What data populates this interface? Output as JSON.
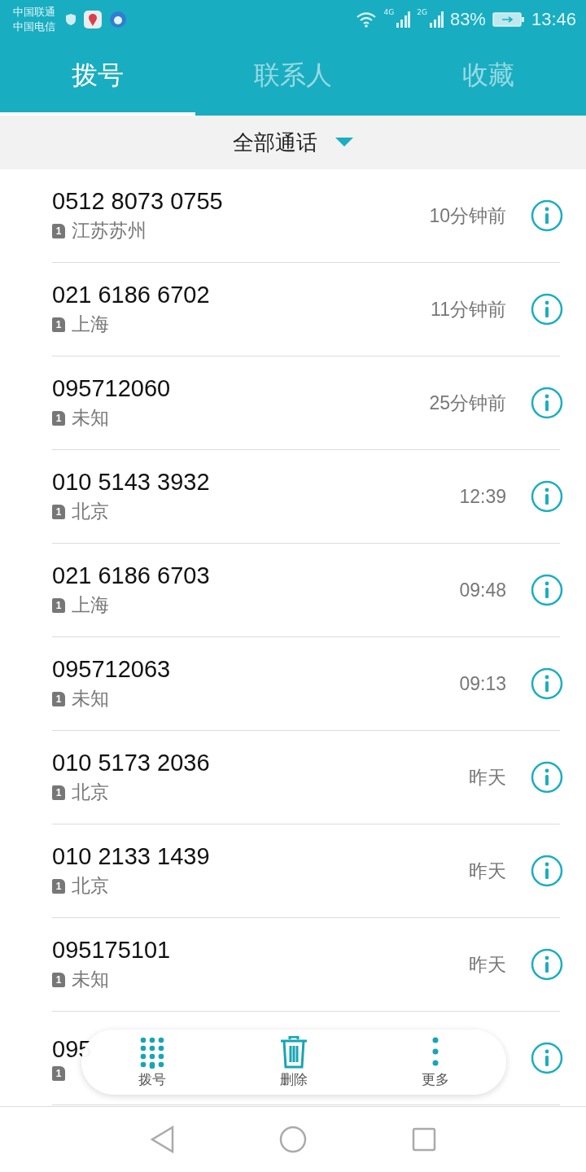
{
  "status_bar": {
    "carriers": [
      "中国联通",
      "中国电信"
    ],
    "battery_percent": "83%",
    "time": "13:46",
    "network_1": "4G",
    "network_2": "2G"
  },
  "tabs": [
    {
      "label": "拨号",
      "selected": true
    },
    {
      "label": "联系人",
      "selected": false
    },
    {
      "label": "收藏",
      "selected": false
    }
  ],
  "filter": {
    "label": "全部通话"
  },
  "calls": [
    {
      "number": "0512 8073 0755",
      "sim": "1",
      "location": "江苏苏州",
      "time": "10分钟前"
    },
    {
      "number": "021 6186 6702",
      "sim": "1",
      "location": "上海",
      "time": "11分钟前"
    },
    {
      "number": "095712060",
      "sim": "1",
      "location": "未知",
      "time": "25分钟前"
    },
    {
      "number": "010 5143 3932",
      "sim": "1",
      "location": "北京",
      "time": "12:39"
    },
    {
      "number": "021 6186 6703",
      "sim": "1",
      "location": "上海",
      "time": "09:48"
    },
    {
      "number": "095712063",
      "sim": "1",
      "location": "未知",
      "time": "09:13"
    },
    {
      "number": "010 5173 2036",
      "sim": "1",
      "location": "北京",
      "time": "昨天"
    },
    {
      "number": "010 2133 1439",
      "sim": "1",
      "location": "北京",
      "time": "昨天"
    },
    {
      "number": "095175101",
      "sim": "1",
      "location": "未知",
      "time": "昨天"
    },
    {
      "number": "095",
      "sim": "1"
    }
  ],
  "action_bar": [
    {
      "kind": "dialpad",
      "label": "拨号"
    },
    {
      "kind": "delete",
      "label": "删除"
    },
    {
      "kind": "more",
      "label": "更多"
    }
  ]
}
